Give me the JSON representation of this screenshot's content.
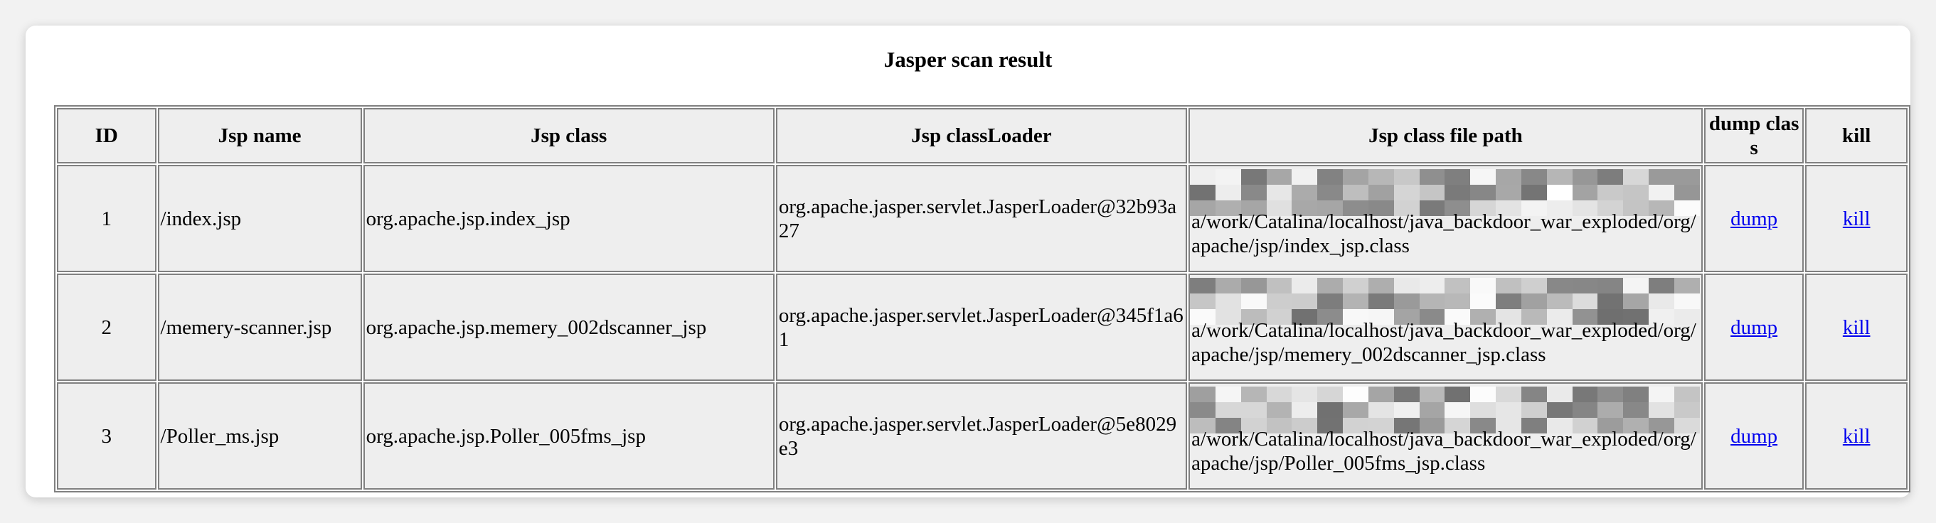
{
  "title": "Jasper scan result",
  "headers": {
    "id": "ID",
    "jsp_name": "Jsp name",
    "jsp_class": "Jsp class",
    "class_loader": "Jsp classLoader",
    "file_path": "Jsp class file path",
    "dump": "dump class",
    "kill": "kill"
  },
  "rows": [
    {
      "id": "1",
      "jsp_name": "/index.jsp",
      "jsp_class": "org.apache.jsp.index_jsp",
      "class_loader": "org.apache.jasper.servlet.JasperLoader@32b93a27",
      "file_path_visible": "a/work/Catalina/localhost/java_backdoor_war_exploded/org/apache/jsp/index_jsp.class",
      "dump_label": "dump",
      "kill_label": "kill"
    },
    {
      "id": "2",
      "jsp_name": "/memery-scanner.jsp",
      "jsp_class": "org.apache.jsp.memery_002dscanner_jsp",
      "class_loader": "org.apache.jasper.servlet.JasperLoader@345f1a61",
      "file_path_visible": "a/work/Catalina/localhost/java_backdoor_war_exploded/org/apache/jsp/memery_002dscanner_jsp.class",
      "dump_label": "dump",
      "kill_label": "kill"
    },
    {
      "id": "3",
      "jsp_name": "/Poller_ms.jsp",
      "jsp_class": "org.apache.jsp.Poller_005fms_jsp",
      "class_loader": "org.apache.jasper.servlet.JasperLoader@5e8029e3",
      "file_path_visible": "a/work/Catalina/localhost/java_backdoor_war_exploded/org/apache/jsp/Poller_005fms_jsp.class",
      "dump_label": "dump",
      "kill_label": "kill"
    }
  ]
}
